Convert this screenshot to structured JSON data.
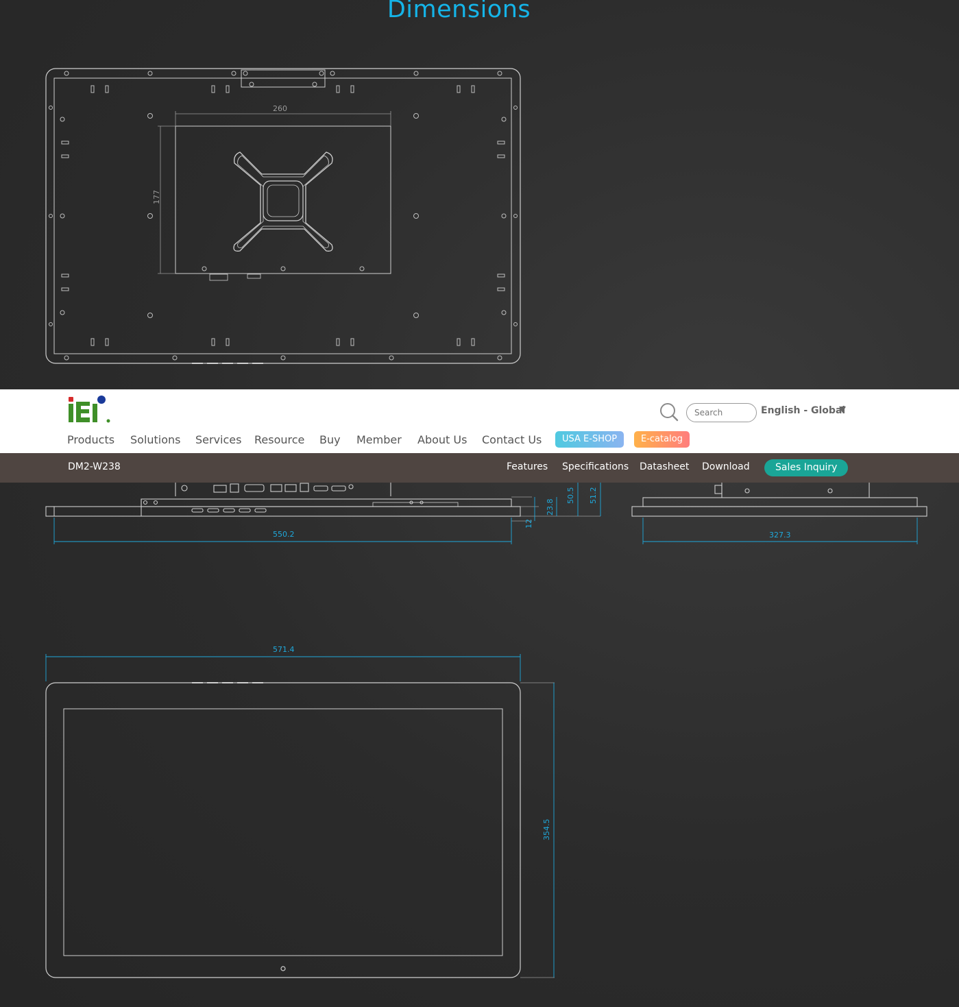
{
  "section_title": "Dimensions",
  "dimensions": {
    "vesa_width": "260",
    "vesa_height": "177",
    "side_depth_1": "50.5",
    "side_depth_2": "51.2",
    "side_thin_1": "23.8",
    "side_thin_2": "12",
    "bottom_width": "550.2",
    "side_width": "327.3",
    "front_width": "571.4",
    "front_height": "354.5"
  },
  "header": {
    "search_placeholder": "Search",
    "language": "English - Global",
    "nav": [
      "Products",
      "Solutions",
      "Services",
      "Resource",
      "Buy",
      "Member",
      "About Us",
      "Contact Us"
    ],
    "shop_label": "USA E-SHOP",
    "catalog_label": "E-catalog"
  },
  "subnav": {
    "model": "DM2-W238",
    "links": [
      "Features",
      "Specifications",
      "Datasheet",
      "Download"
    ],
    "inquiry_label": "Sales Inquiry"
  },
  "colors": {
    "accent": "#15b4e8",
    "dimension": "#1fa9dc",
    "subbar": "#4f4541",
    "inquiry": "#1aa597"
  }
}
